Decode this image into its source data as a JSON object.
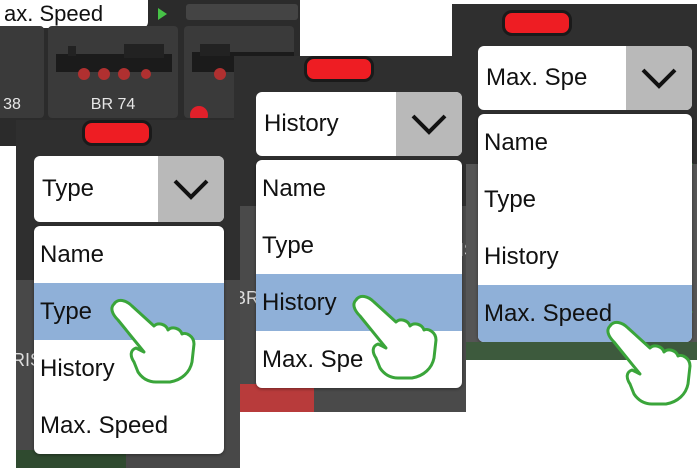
{
  "back_header": {
    "label": "ax. Speed"
  },
  "back_tiles": [
    {
      "label": "38"
    },
    {
      "label": "BR 74"
    },
    {
      "label": "B"
    }
  ],
  "panels": [
    {
      "dropdown_value": "Type",
      "menu": [
        "Name",
        "Type",
        "History",
        "Max. Speed"
      ],
      "selected_index": 1
    },
    {
      "dropdown_value": "History",
      "menu": [
        "Name",
        "Type",
        "History",
        "Max. Spe"
      ],
      "selected_index": 2
    },
    {
      "dropdown_value": "Max. Spe",
      "menu": [
        "Name",
        "Type",
        "History",
        "Max. Speed"
      ],
      "selected_index": 3
    }
  ],
  "bg_fragments": [
    "RIS",
    "BR",
    "RIS",
    "1"
  ],
  "colors": {
    "pill": "#ee1d23",
    "selection": "#8fb0d8",
    "hand_stroke": "#3aa53a",
    "panel_bg": "#2f2f2f"
  },
  "icons": {
    "chevron": "chevron-down-icon",
    "hand": "pointing-hand-icon",
    "play": "play-triangle-icon"
  }
}
